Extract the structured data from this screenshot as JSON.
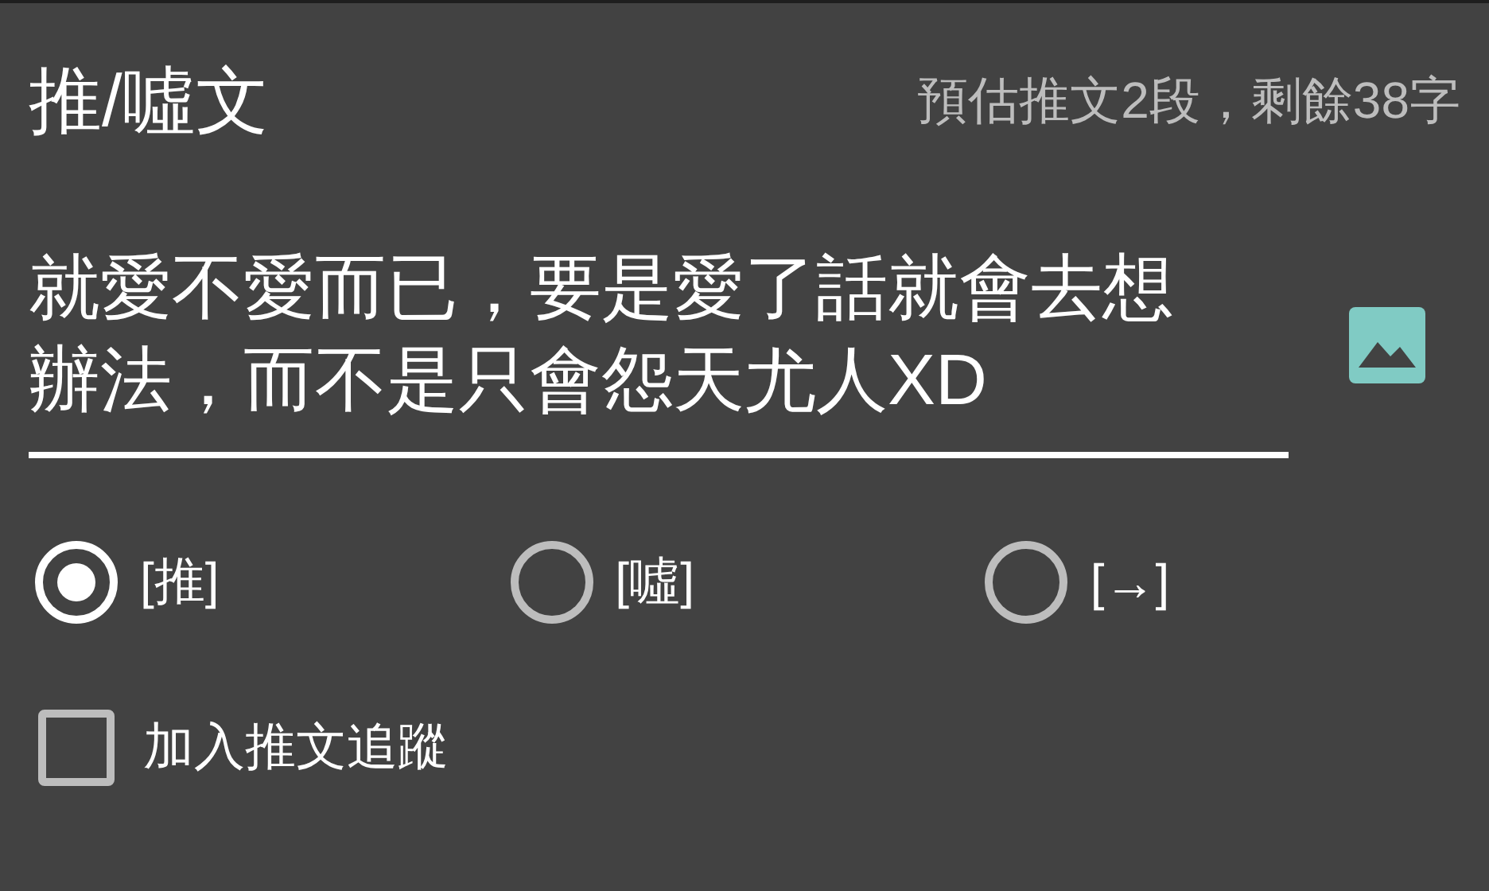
{
  "dialog": {
    "title": "推/噓文",
    "counter": "預估推文2段，剩餘38字"
  },
  "comment_field": {
    "value": "就愛不愛而已，要是愛了話就會去想辦法，而不是只會怨天尤人XD"
  },
  "push_types": [
    {
      "label": "[推]",
      "selected": true
    },
    {
      "label": "[噓]",
      "selected": false
    },
    {
      "label": "[→]",
      "selected": false
    }
  ],
  "track_checkbox": {
    "label": "加入推文追蹤",
    "checked": false
  }
}
